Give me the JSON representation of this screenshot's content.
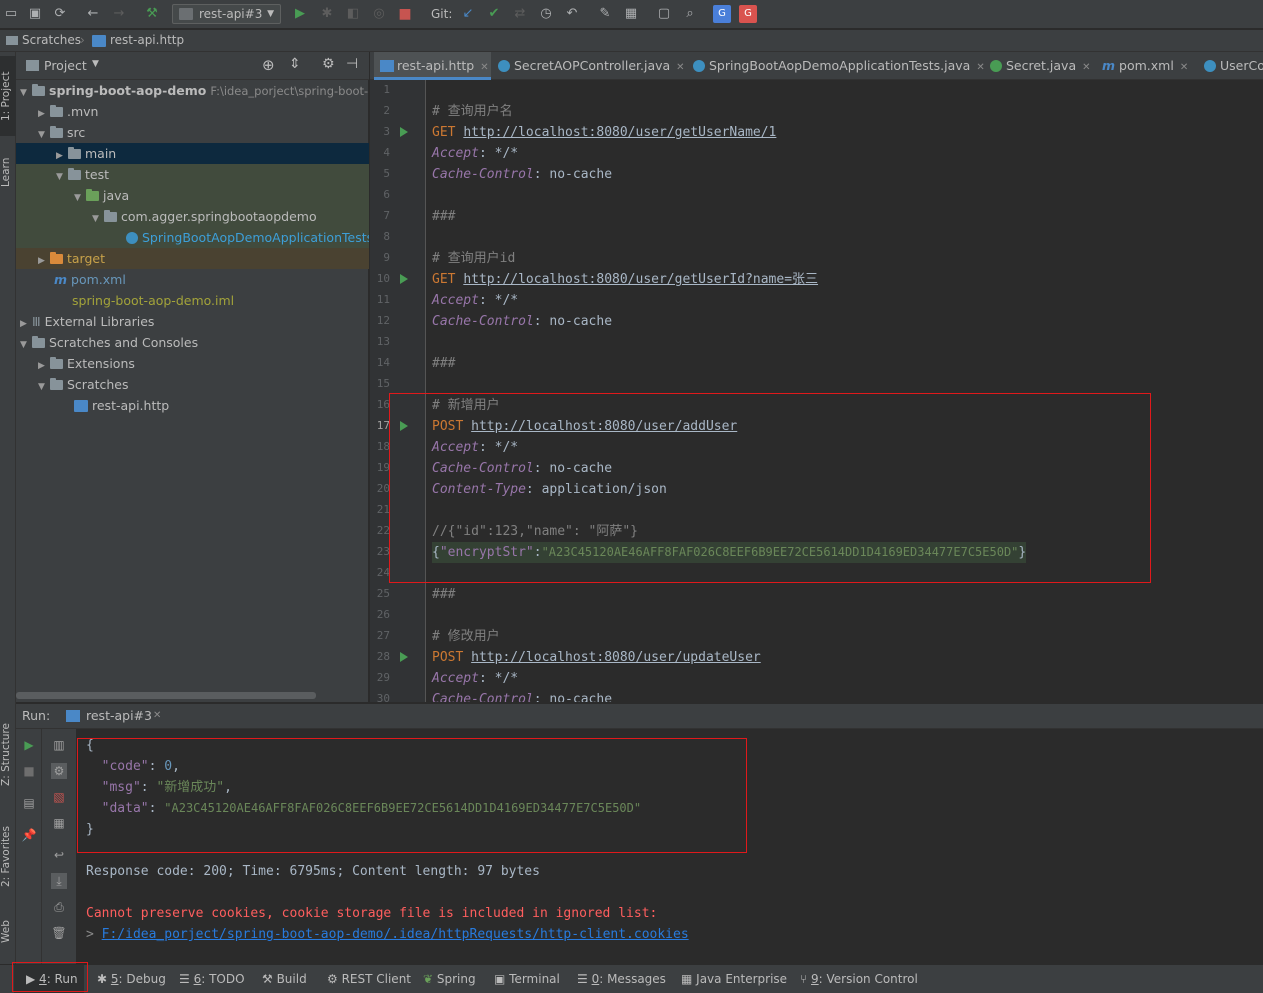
{
  "toolbar": {
    "run_config": "rest-api#3",
    "git_label": "Git:"
  },
  "navbar": {
    "crumb1": "Scratches",
    "crumb2": "rest-api.http"
  },
  "left_strip": {
    "project": "1: Project",
    "learn": "Learn",
    "structure": "Z: Structure",
    "favorites": "2: Favorites",
    "web": "Web"
  },
  "project_panel": {
    "title": "Project",
    "tree": [
      {
        "label": "spring-boot-aop-demo",
        "extra": "F:\\idea_porject\\spring-boot-a"
      },
      {
        "label": ".mvn"
      },
      {
        "label": "src"
      },
      {
        "label": "main"
      },
      {
        "label": "test"
      },
      {
        "label": "java"
      },
      {
        "label": "com.agger.springbootaopdemo"
      },
      {
        "label": "SpringBootAopDemoApplicationTests"
      },
      {
        "label": "target"
      },
      {
        "label": "pom.xml"
      },
      {
        "label": "spring-boot-aop-demo.iml"
      },
      {
        "label": "External Libraries"
      },
      {
        "label": "Scratches and Consoles"
      },
      {
        "label": "Extensions"
      },
      {
        "label": "Scratches"
      },
      {
        "label": "rest-api.http"
      }
    ]
  },
  "editor_tabs": [
    {
      "label": "rest-api.http"
    },
    {
      "label": "SecretAOPController.java"
    },
    {
      "label": "SpringBootAopDemoApplicationTests.java"
    },
    {
      "label": "Secret.java"
    },
    {
      "label": "pom.xml"
    },
    {
      "label": "UserCo"
    }
  ],
  "editor": {
    "line_numbers": [
      "1",
      "2",
      "3",
      "4",
      "5",
      "6",
      "7",
      "8",
      "9",
      "10",
      "11",
      "12",
      "13",
      "14",
      "15",
      "16",
      "17",
      "18",
      "19",
      "20",
      "21",
      "22",
      "23",
      "24",
      "25",
      "26",
      "27",
      "28",
      "29",
      "30"
    ],
    "l2": "# 查询用户名",
    "l3_method": "GET",
    "l3_url": "http://localhost:8080/user/getUserName/1",
    "accept_key": "Accept",
    "accept_val": ": */*",
    "cache_key": "Cache-Control",
    "cache_val": ": no-cache",
    "sep": "###",
    "l9": "# 查询用户id",
    "l10_method": "GET",
    "l10_url": "http://localhost:8080/user/getUserId?name=张三",
    "l16": "# 新增用户",
    "l17_method": "POST",
    "l17_url": "http://localhost:8080/user/addUser",
    "ct_key": "Content-Type",
    "ct_val": ": application/json",
    "l22": "//{\"id\":123,\"name\": \"阿萨\"}",
    "l23_open": "{",
    "l23_key": "\"encryptStr\"",
    "l23_colon": ":",
    "l23_val": "\"A23C45120AE46AFF8FAF026C8EEF6B9EE72CE5614DD1D4169ED34477E7C5E50D\"",
    "l23_close": "}",
    "l27": "# 修改用户",
    "l28_method": "POST",
    "l28_url": "http://localhost:8080/user/updateUser"
  },
  "run_panel": {
    "label": "Run:",
    "tab": "rest-api#3"
  },
  "console": {
    "brace_open": "{",
    "code_key": "\"code\"",
    "code_val": "0",
    "msg_key": "\"msg\"",
    "msg_val": "\"新增成功\"",
    "data_key": "\"data\"",
    "data_val": "\"A23C45120AE46AFF8FAF026C8EEF6B9EE72CE5614DD1D4169ED34477E7C5E50D\"",
    "brace_close": "}",
    "response": "Response code: 200; Time: 6795ms; Content length: 97 bytes",
    "cookie_warn": "Cannot preserve cookies, cookie storage file is included in ignored list:",
    "cookie_path": "F:/idea_porject/spring-boot-aop-demo/.idea/httpRequests/http-client.cookies"
  },
  "bottom_bar": {
    "run_num": "4",
    "run": ": Run",
    "debug_num": "5",
    "debug": ": Debug",
    "todo_num": "6",
    "todo": ": TODO",
    "build": "Build",
    "rest": "REST Client",
    "spring": "Spring",
    "terminal": "Terminal",
    "messages_num": "0",
    "messages": ": Messages",
    "java_ent": "Java Enterprise",
    "vc_num": "9",
    "vc": ": Version Control"
  },
  "colors": {
    "accent": "#4a88c7",
    "annotation_box": "#e0191b",
    "error_text": "#ff5e5e"
  }
}
